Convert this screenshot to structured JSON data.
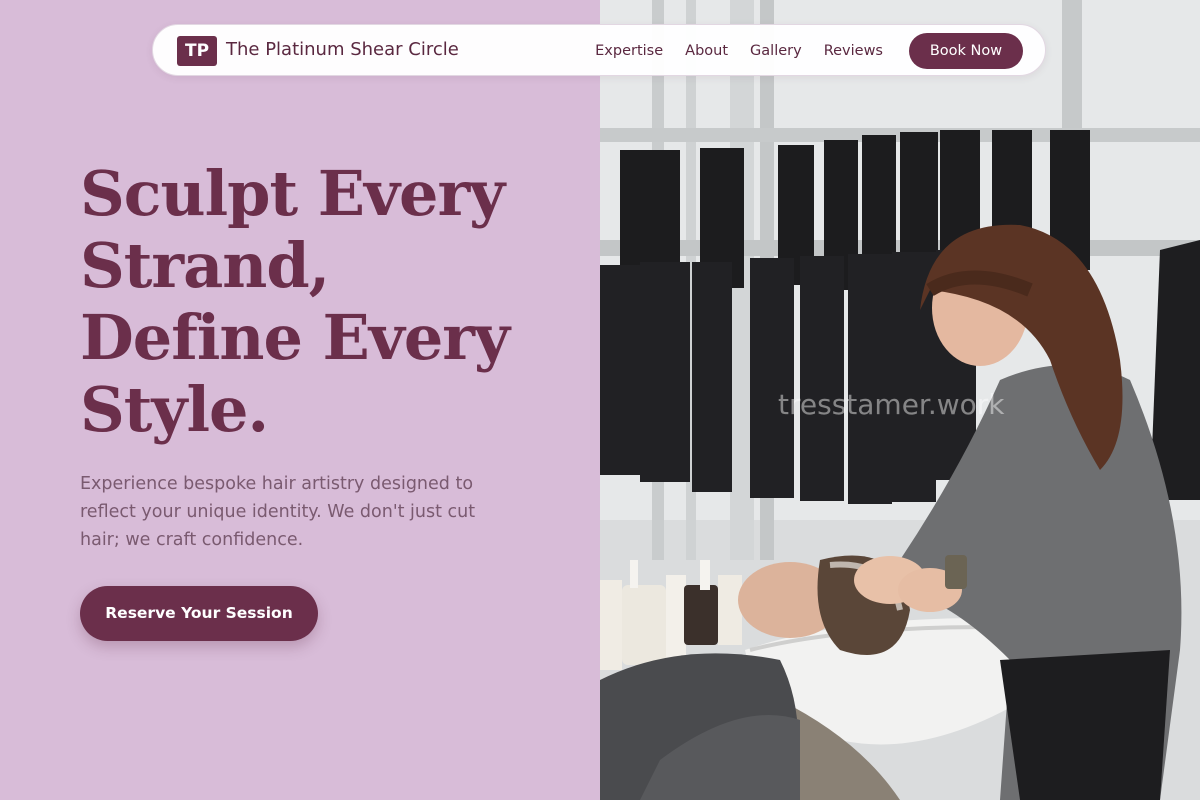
{
  "brand": {
    "logo_initials": "TP",
    "name": "The Platinum Shear Circle"
  },
  "nav": {
    "links": [
      "Expertise",
      "About",
      "Gallery",
      "Reviews"
    ],
    "book_label": "Book Now"
  },
  "hero": {
    "headline_lines": [
      "Sculpt Every",
      "Strand,",
      "Define Every",
      "Style."
    ],
    "subtext": "Experience bespoke hair artistry designed to reflect your unique identity. We don't just cut hair; we craft confidence.",
    "cta_label": "Reserve Your Session"
  },
  "photo": {
    "description_icon": "salon-hair-wash-photo",
    "watermark": "tresstamer.work"
  },
  "colors": {
    "left_panel": "#d8bcd8",
    "accent": "#6b2f4b",
    "body_text": "#7a5a70"
  }
}
